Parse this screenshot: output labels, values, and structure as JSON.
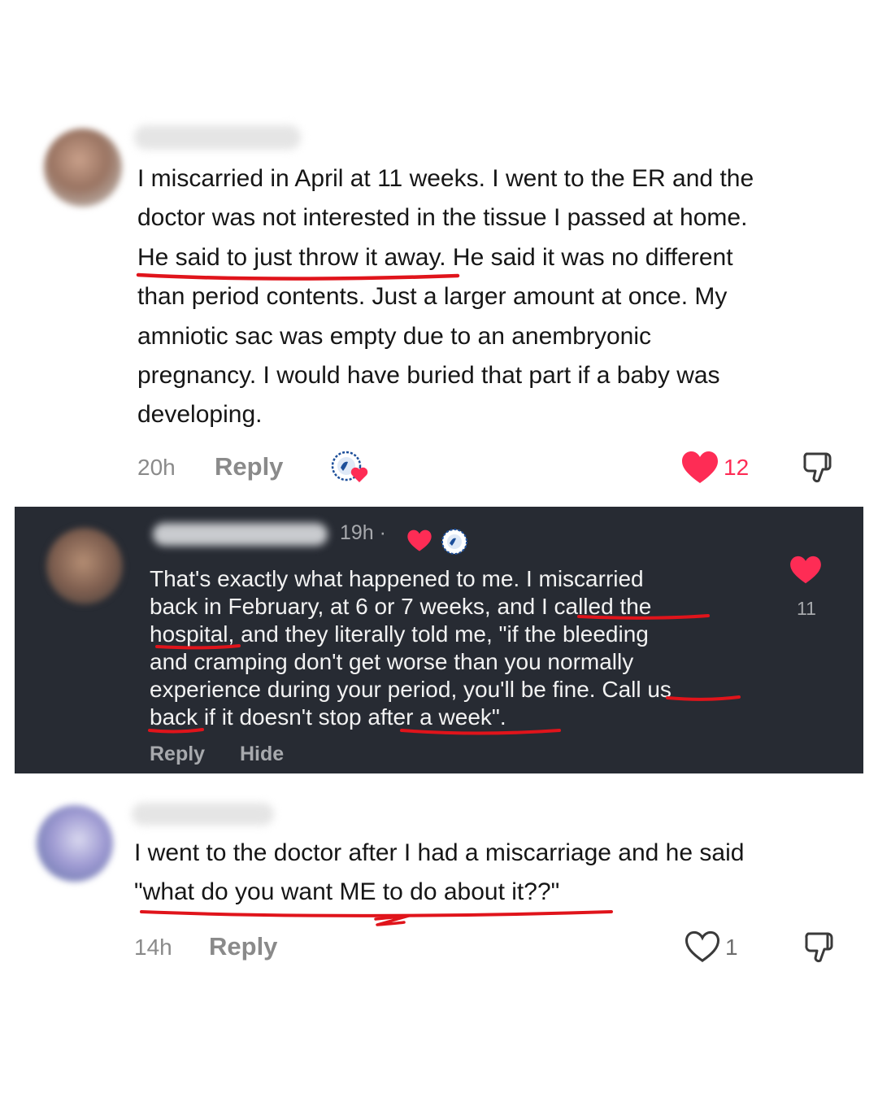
{
  "comments": [
    {
      "lines": [
        "I miscarried in April at 11 weeks. I went to the ER and the",
        "doctor was not interested in the tissue I passed at home.",
        "He said to just throw it away. He said it was no different",
        "than period contents. Just a larger amount at once. My",
        "amniotic sac was empty due to an anembryonic",
        "pregnancy. I would have buried that part if a baby was",
        "developing."
      ],
      "time": "20h",
      "reply_label": "Reply",
      "like_count": "12",
      "liked": true
    },
    {
      "lines": [
        "That's exactly what happened to me. I miscarried",
        "back in February, at 6 or 7 weeks, and I called the",
        "hospital, and they literally told me, \"if the bleeding",
        "and cramping don't get worse than you normally",
        "experience during your period, you'll be fine. Call us",
        "back if it doesn't stop after a week\"."
      ],
      "time": "19h ·",
      "reply_label": "Reply",
      "hide_label": "Hide",
      "like_count": "11",
      "liked": true
    },
    {
      "lines": [
        "I went to the doctor after I had a miscarriage and he said",
        "\"what do you want ME to do about it??\""
      ],
      "time": "14h",
      "reply_label": "Reply",
      "like_count": "1",
      "liked": false
    }
  ],
  "colors": {
    "like_red": "#fe2c55",
    "underline_red": "#e0141b",
    "dark_card": "#272b33"
  }
}
